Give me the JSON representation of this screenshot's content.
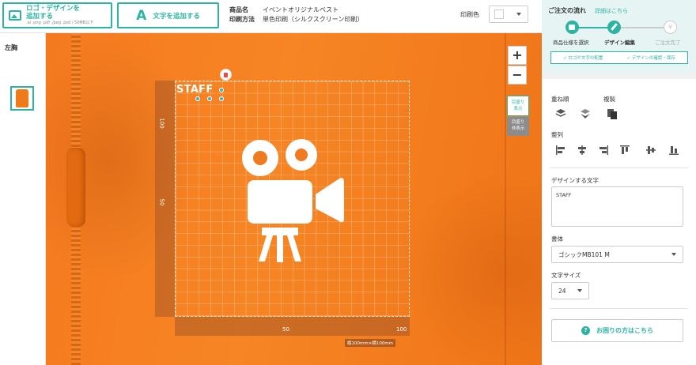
{
  "topbar": {
    "logo_button": {
      "line1": "ロゴ・デザインを",
      "line2": "追加する",
      "formats": ".ai .png .pdf .jpeg .psd / 50MB以下",
      "icon": "image-icon"
    },
    "text_button": {
      "glyph": "A",
      "label": "文字を追加する"
    },
    "product_key": "商品名",
    "product_value": "イベントオリジナルベスト",
    "method_key": "印刷方法",
    "method_value": "単色印刷（シルクスクリーン印刷）",
    "print_color_label": "印刷色",
    "print_color_value": "#ffffff"
  },
  "left_panel": {
    "position_label": "左胸",
    "garment_color": "#ef7a1a"
  },
  "canvas": {
    "zoom_in": "+",
    "zoom_out": "−",
    "grid_show": [
      "目盛り",
      "表示"
    ],
    "grid_hide": [
      "目盛り",
      "非表示"
    ],
    "ruler_left": {
      "top": "100",
      "mid": "50"
    },
    "ruler_bottom": {
      "mid": "50",
      "right": "100"
    },
    "size_label": "縦100mm×横100mm",
    "design_text": "STAFF",
    "design_icon": "movie-camera-icon",
    "garment_color": "#f57a1f"
  },
  "right_panel": {
    "flow_title": "ご注文の流れ",
    "flow_detail": "詳細はこちら",
    "steps": [
      {
        "label": "商品仕様を選択"
      },
      {
        "label": "デザイン編集"
      },
      {
        "label": "ご注文完了",
        "symbol": "¥"
      }
    ],
    "checks": [
      "✓ ロゴや文字の配置",
      "✓ デザインの確認・保存"
    ],
    "layer_label": "重ね順",
    "duplicate_label": "複製",
    "align_label": "整列",
    "text_label": "デザインする文字",
    "text_value": "STAFF",
    "font_label": "書体",
    "font_value": "ゴシックMB101 M",
    "size_label": "文字サイズ",
    "size_value": "24",
    "help_label": "お困りの方はこちら",
    "accent": "#2bb3a3"
  }
}
